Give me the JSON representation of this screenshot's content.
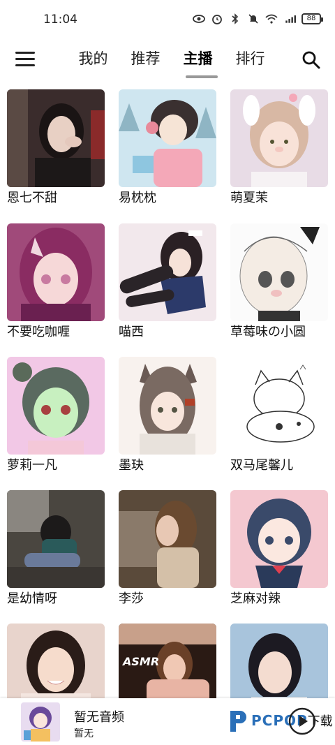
{
  "status_bar": {
    "time": "11:04",
    "battery": "88",
    "icons": [
      "eye-icon",
      "alarm-icon",
      "bluetooth-icon",
      "mute-icon",
      "wifi-icon",
      "signal-5g-icon",
      "battery-icon"
    ]
  },
  "header": {
    "tabs": [
      {
        "label": "我的",
        "active": false
      },
      {
        "label": "推荐",
        "active": false
      },
      {
        "label": "主播",
        "active": true
      },
      {
        "label": "排行",
        "active": false
      }
    ]
  },
  "anchors": [
    {
      "name": "恩七不甜",
      "art": "photo-dark"
    },
    {
      "name": "易枕枕",
      "art": "anime-winter"
    },
    {
      "name": "萌夏茉",
      "art": "photo-bunny"
    },
    {
      "name": "不要吃咖喱",
      "art": "anime-pink"
    },
    {
      "name": "喵西",
      "art": "anime-dark-hair"
    },
    {
      "name": "草莓味の小圆",
      "art": "manga-sketch"
    },
    {
      "name": "萝莉一凡",
      "art": "anime-green"
    },
    {
      "name": "墨玦",
      "art": "anime-cat-ear"
    },
    {
      "name": "双马尾馨儿",
      "art": "sketch-chibi"
    },
    {
      "name": "是幼情呀",
      "art": "photo-sitting"
    },
    {
      "name": "李莎",
      "art": "photo-warm"
    },
    {
      "name": "芝麻对辣",
      "art": "anime-schoolgirl"
    },
    {
      "name": "",
      "art": "photo-smile"
    },
    {
      "name": "",
      "art": "photo-asmr"
    },
    {
      "name": "",
      "art": "photo-blue"
    }
  ],
  "asmr_label": "ASMR",
  "player": {
    "title": "暂无音频",
    "subtitle": "暂无",
    "watermark_brand": "PCPOP",
    "watermark_cn": "下载"
  },
  "colors": {
    "accent_tab_indicator": "#999999",
    "watermark_blue": "#2a6fb8"
  }
}
